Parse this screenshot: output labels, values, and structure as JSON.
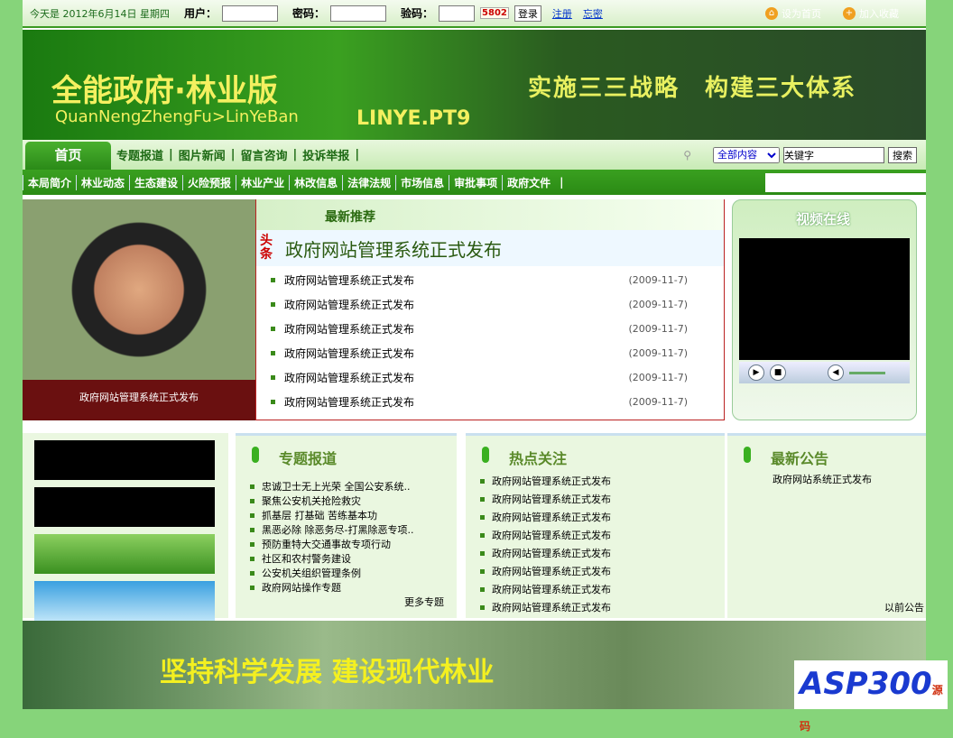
{
  "topbar": {
    "date": "今天是 2012年6月14日 星期四",
    "user_label": "用户：",
    "pass_label": "密码：",
    "code_label": "验码：",
    "captcha": "5802",
    "login": "登录",
    "register": "注册",
    "forgot": "忘密",
    "set_home": "设为首页",
    "favorite": "加入收藏"
  },
  "banner": {
    "title": "全能政府·林业版",
    "pinyin": "QuanNengZhengFu>LinYeBan",
    "brand": "LINYE.PT9",
    "slogan": "实施三三战略　构建三大体系"
  },
  "nav": {
    "home": "首页",
    "items": [
      "专题报道",
      "图片新闻",
      "留言咨询",
      "投诉举报"
    ],
    "search_scope": "全部内容",
    "search_value": "关键字",
    "search_btn": "搜索"
  },
  "subnav": [
    "本局简介",
    "林业动态",
    "生态建设",
    "火险预报",
    "林业产业",
    "林改信息",
    "法律法规",
    "市场信息",
    "审批事项",
    "政府文件"
  ],
  "photo": {
    "caption": "政府网站管理系统正式发布"
  },
  "news": {
    "title": "最新推荐",
    "headline_tag": "头条",
    "headline": "政府网站管理系统正式发布",
    "items": [
      {
        "t": "政府网站管理系统正式发布",
        "d": "(2009-11-7)"
      },
      {
        "t": "政府网站管理系统正式发布",
        "d": "(2009-11-7)"
      },
      {
        "t": "政府网站管理系统正式发布",
        "d": "(2009-11-7)"
      },
      {
        "t": "政府网站管理系统正式发布",
        "d": "(2009-11-7)"
      },
      {
        "t": "政府网站管理系统正式发布",
        "d": "(2009-11-7)"
      },
      {
        "t": "政府网站管理系统正式发布",
        "d": "(2009-11-7)"
      }
    ]
  },
  "video": {
    "title": "视频在线"
  },
  "topics": {
    "title": "专题报道",
    "items": [
      "忠诚卫士无上光荣 全国公安系统..",
      "聚焦公安机关抢险救灾",
      "抓基层 打基础 苦练基本功",
      "黑恶必除 除恶务尽-打黑除恶专项..",
      "预防重特大交通事故专项行动",
      "社区和农村警务建设",
      "公安机关组织管理条例",
      "政府网站操作专题"
    ],
    "more": "更多专题"
  },
  "hot": {
    "title": "热点关注",
    "items": [
      "政府网站管理系统正式发布",
      "政府网站管理系统正式发布",
      "政府网站管理系统正式发布",
      "政府网站管理系统正式发布",
      "政府网站管理系统正式发布",
      "政府网站管理系统正式发布",
      "政府网站管理系统正式发布",
      "政府网站管理系统正式发布"
    ]
  },
  "notice": {
    "title": "最新公告",
    "items": [
      "政府网站系统正式发布"
    ],
    "more": "以前公告"
  },
  "bottom_banner": {
    "slogan": "坚持科学发展 建设现代林业"
  },
  "watermark": {
    "text": "ASP300源码"
  }
}
